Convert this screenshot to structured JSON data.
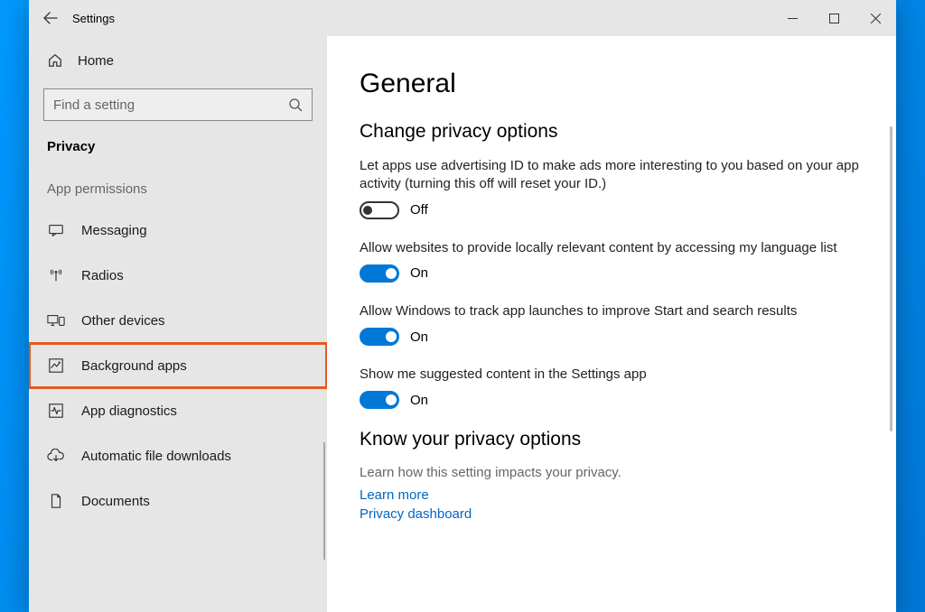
{
  "window": {
    "title": "Settings"
  },
  "sidebar": {
    "home": "Home",
    "search_placeholder": "Find a setting",
    "category": "Privacy",
    "section_label": "App permissions",
    "items": [
      {
        "icon": "messaging",
        "label": "Messaging"
      },
      {
        "icon": "radios",
        "label": "Radios"
      },
      {
        "icon": "otherdevices",
        "label": "Other devices"
      },
      {
        "icon": "backgroundapps",
        "label": "Background apps",
        "highlighted": true
      },
      {
        "icon": "appdiag",
        "label": "App diagnostics"
      },
      {
        "icon": "download",
        "label": "Automatic file downloads"
      },
      {
        "icon": "documents",
        "label": "Documents"
      }
    ]
  },
  "main": {
    "title": "General",
    "section1_title": "Change privacy options",
    "settings": [
      {
        "desc": "Let apps use advertising ID to make ads more interesting to you based on your app activity (turning this off will reset your ID.)",
        "state": "off",
        "state_label": "Off"
      },
      {
        "desc": "Allow websites to provide locally relevant content by accessing my language list",
        "state": "on",
        "state_label": "On"
      },
      {
        "desc": "Allow Windows to track app launches to improve Start and search results",
        "state": "on",
        "state_label": "On"
      },
      {
        "desc": "Show me suggested content in the Settings app",
        "state": "on",
        "state_label": "On"
      }
    ],
    "section2_title": "Know your privacy options",
    "section2_desc": "Learn how this setting impacts your privacy.",
    "links": [
      "Learn more",
      "Privacy dashboard"
    ]
  }
}
